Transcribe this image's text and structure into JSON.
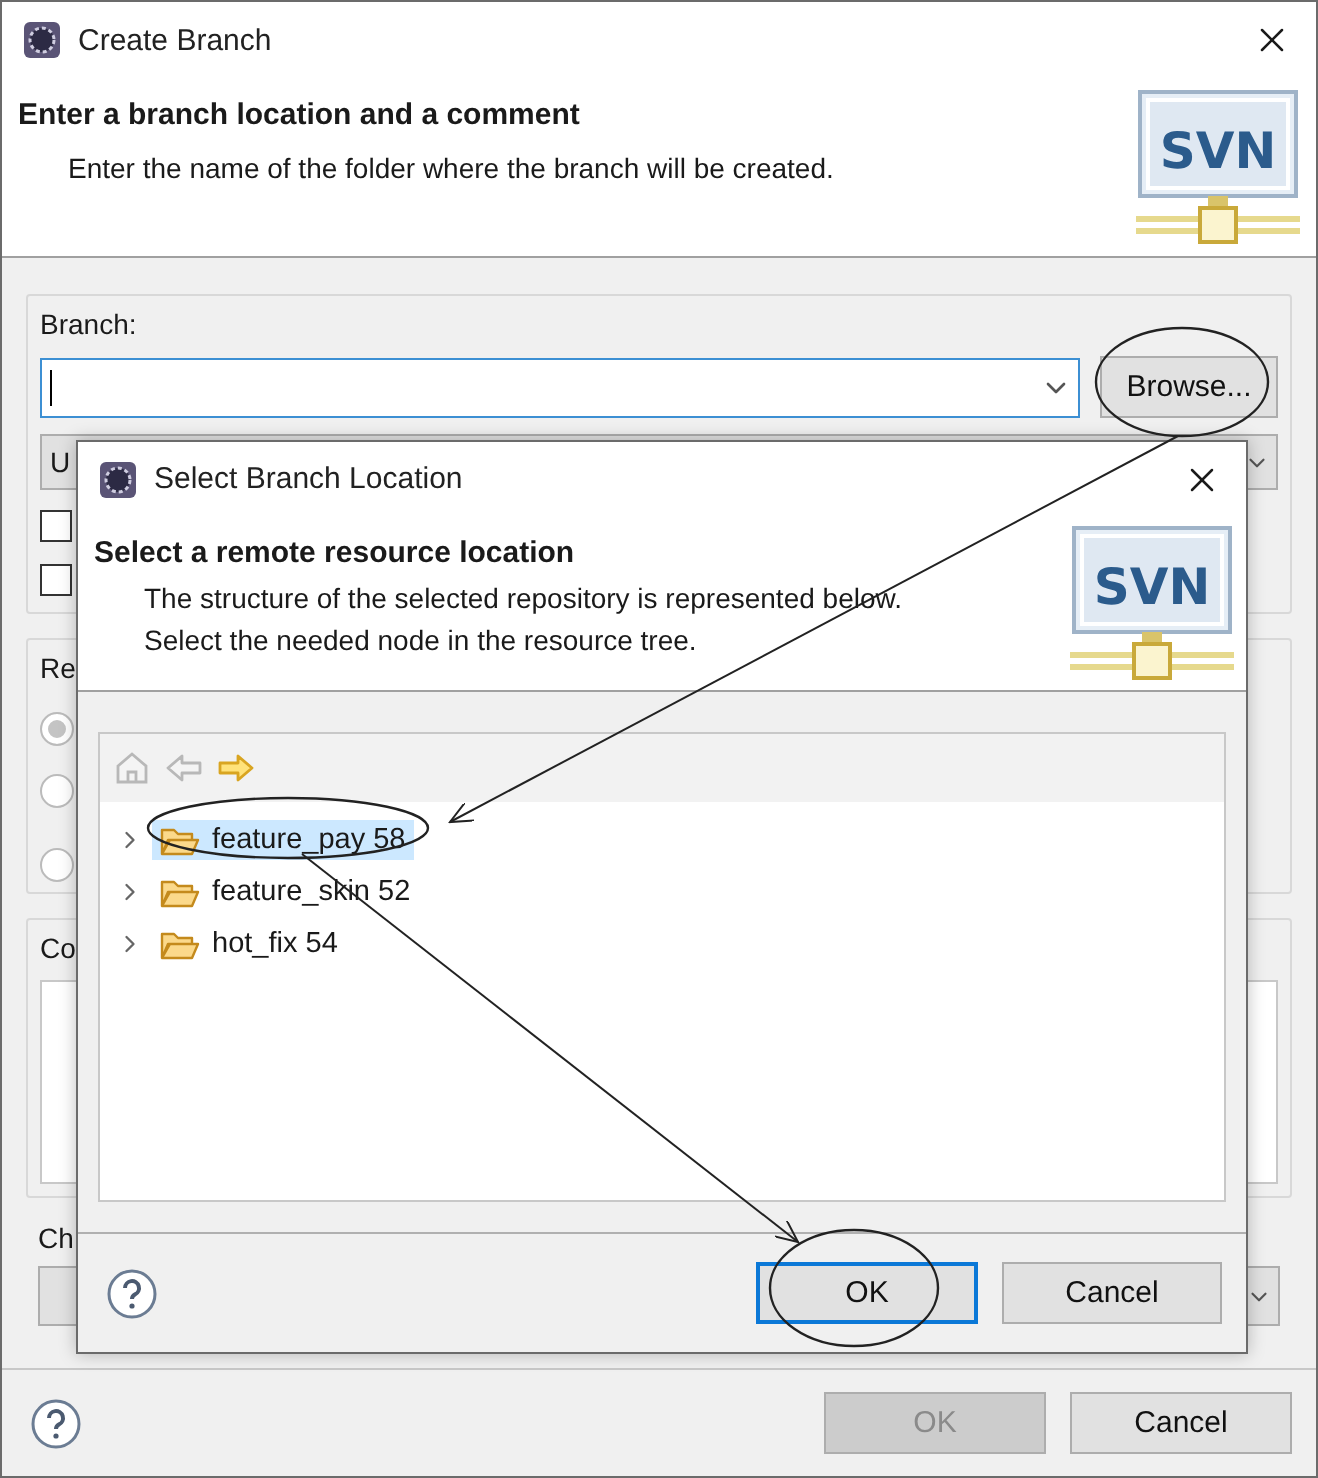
{
  "window": {
    "title": "Create Branch"
  },
  "header": {
    "title": "Enter a branch location and a comment",
    "description": "Enter the name of the folder where the branch will be created.",
    "logo": "SVN"
  },
  "branch": {
    "label": "Branch:",
    "browse_button": "Browse..."
  },
  "partly_hidden": {
    "combo_text": "U",
    "group_2_label": "Re",
    "group_3_label": "Co",
    "label_4": "Ch"
  },
  "checkboxes": [
    {
      "checked": false
    },
    {
      "checked": false
    }
  ],
  "radios": [
    {
      "selected": true
    },
    {
      "selected": false
    },
    {
      "selected": false
    }
  ],
  "buttons": [
    {
      "label": "OK",
      "disabled": true
    },
    {
      "label": "Cancel",
      "disabled": false
    }
  ],
  "dialog": {
    "title": "Select Branch Location",
    "header": {
      "title": "Select a remote resource location",
      "description": "The structure of the selected repository is represented below. Select the needed node in the resource tree.",
      "logo": "SVN"
    },
    "toolbar": [
      {
        "kind": "home",
        "disabled": true
      },
      {
        "kind": "back",
        "disabled": true
      },
      {
        "kind": "forward",
        "disabled": false
      }
    ],
    "tree": [
      {
        "label": "feature_pay 58",
        "selected": true
      },
      {
        "label": "feature_skin 52",
        "selected": false
      },
      {
        "label": "hot_fix 54",
        "selected": false
      }
    ],
    "buttons": [
      {
        "label": "OK",
        "focused": true
      },
      {
        "label": "Cancel",
        "focused": false
      }
    ]
  }
}
